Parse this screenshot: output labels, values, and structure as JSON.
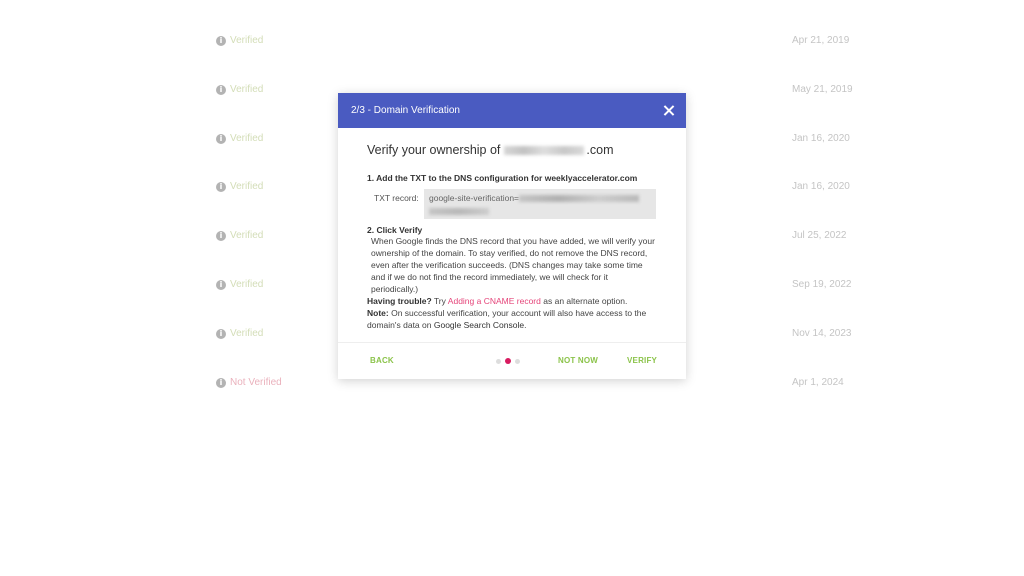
{
  "rows": [
    {
      "status": "Verified",
      "date": "Apr 21, 2019",
      "verified": true
    },
    {
      "status": "Verified",
      "date": "May 21, 2019",
      "verified": true
    },
    {
      "status": "Verified",
      "date": "Jan 16, 2020",
      "verified": true
    },
    {
      "status": "Verified",
      "date": "Jan 16, 2020",
      "verified": true
    },
    {
      "status": "Verified",
      "date": "Jul 25, 2022",
      "verified": true
    },
    {
      "status": "Verified",
      "date": "Sep 19, 2022",
      "verified": true
    },
    {
      "status": "Verified",
      "date": "Nov 14, 2023",
      "verified": true
    },
    {
      "status": "Not Verified",
      "date": "Apr 1, 2024",
      "verified": false
    }
  ],
  "info_icon_glyph": "i",
  "dialog": {
    "title": "2/3 - Domain Verification",
    "heading_prefix": "Verify your ownership of",
    "heading_suffix": ".com",
    "step1_title": "1. Add the TXT to the DNS configuration for weeklyaccelerator.com",
    "txt_label": "TXT record:",
    "txt_value_prefix": "google-site-verification=",
    "step2_title": "2. Click Verify",
    "step2_text": "When Google finds the DNS record that you have added, we will verify your ownership of the domain. To stay verified, do not remove the DNS record, even after the verification succeeds. (DNS changes may take some time and if we do not find the record immediately, we will check for it periodically.)",
    "trouble_label": "Having trouble?",
    "trouble_try": "Try",
    "trouble_link": "Adding a CNAME record",
    "trouble_suffix": "as an alternate option.",
    "note_label": "Note:",
    "note_text": "On successful verification, your account will also have access to the domain's data on",
    "note_link": "Google Search Console",
    "note_end": ".",
    "back_label": "BACK",
    "not_now_label": "NOT NOW",
    "verify_label": "VERIFY",
    "step_current": 2,
    "step_total": 3
  },
  "colors": {
    "header": "#4a5bc1",
    "action": "#8bc34a",
    "link": "#e5457a",
    "active_dot": "#d81b60"
  }
}
